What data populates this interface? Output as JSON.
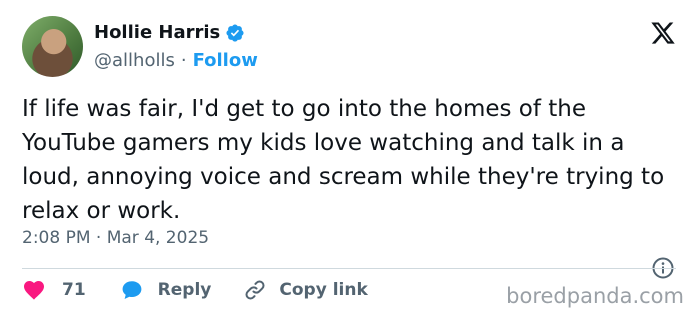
{
  "author": {
    "name": "Hollie Harris",
    "handle": "@allholls",
    "separator": "·",
    "follow_label": "Follow"
  },
  "tweet": {
    "text": "If life was fair, I'd get to go into the homes of the YouTube gamers my kids love watching and talk in a loud, annoying voice and scream while they're trying to relax or work.",
    "timestamp": "2:08 PM · Mar 4, 2025"
  },
  "actions": {
    "like_count": "71",
    "reply_label": "Reply",
    "copy_label": "Copy link"
  },
  "watermark": "boredpanda.com",
  "colors": {
    "accent": "#1d9bf0",
    "like": "#f91880",
    "text": "#0f1419",
    "muted": "#536471"
  },
  "icons": [
    "verified-badge-icon",
    "x-logo-icon",
    "info-icon",
    "heart-icon",
    "reply-bubble-icon",
    "link-icon"
  ]
}
